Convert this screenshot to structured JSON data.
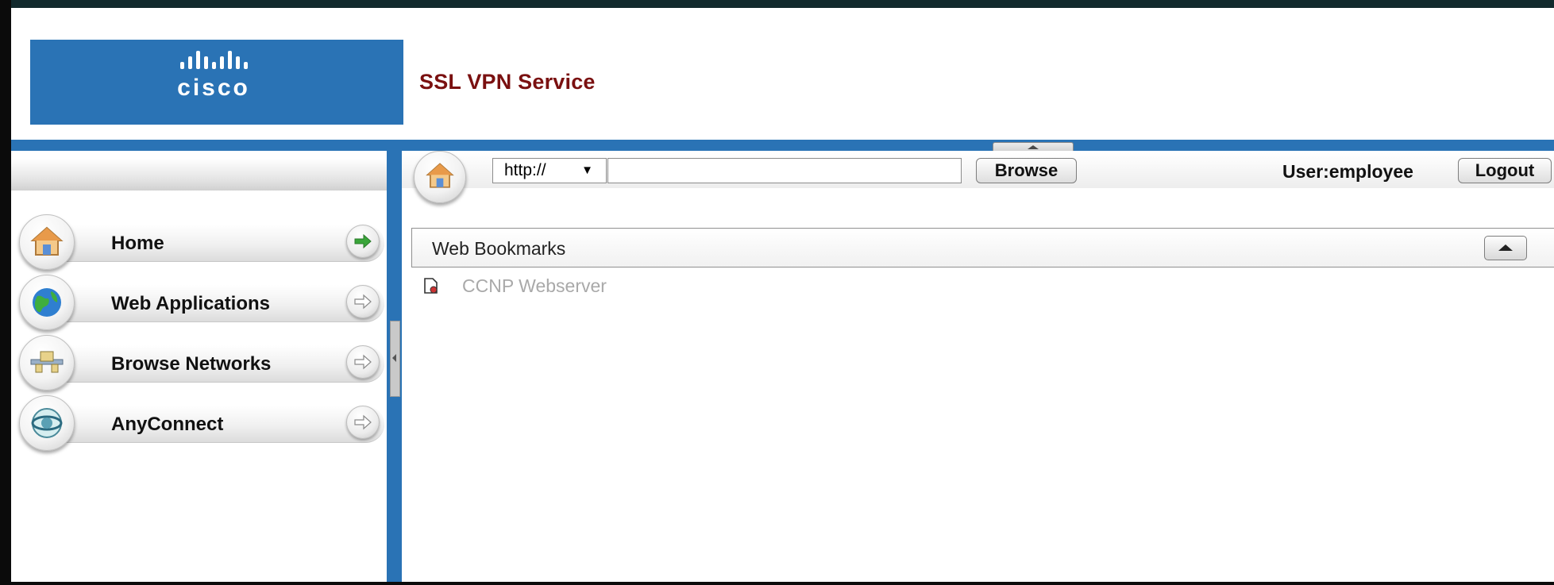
{
  "brand": {
    "logo_text": "cisco",
    "app_title": "SSL VPN Service"
  },
  "colors": {
    "brand_blue": "#2a73b5",
    "title_red": "#7a1010",
    "arrow_green": "#3aa53a",
    "link_gray": "#a9a9a9"
  },
  "sidebar": {
    "items": [
      {
        "label": "Home",
        "icon": "home-icon",
        "active": true
      },
      {
        "label": "Web Applications",
        "icon": "globe-icon",
        "active": false
      },
      {
        "label": "Browse Networks",
        "icon": "network-icon",
        "active": false
      },
      {
        "label": "AnyConnect",
        "icon": "anyconnect-icon",
        "active": false
      }
    ]
  },
  "toolbar": {
    "protocol": "http://",
    "url_value": "",
    "browse_label": "Browse",
    "user_label": "User:employee",
    "logout_label": "Logout"
  },
  "bookmarks": {
    "title": "Web Bookmarks",
    "items": [
      {
        "label": "CCNP Webserver",
        "icon": "bookmark-page-icon"
      }
    ]
  }
}
